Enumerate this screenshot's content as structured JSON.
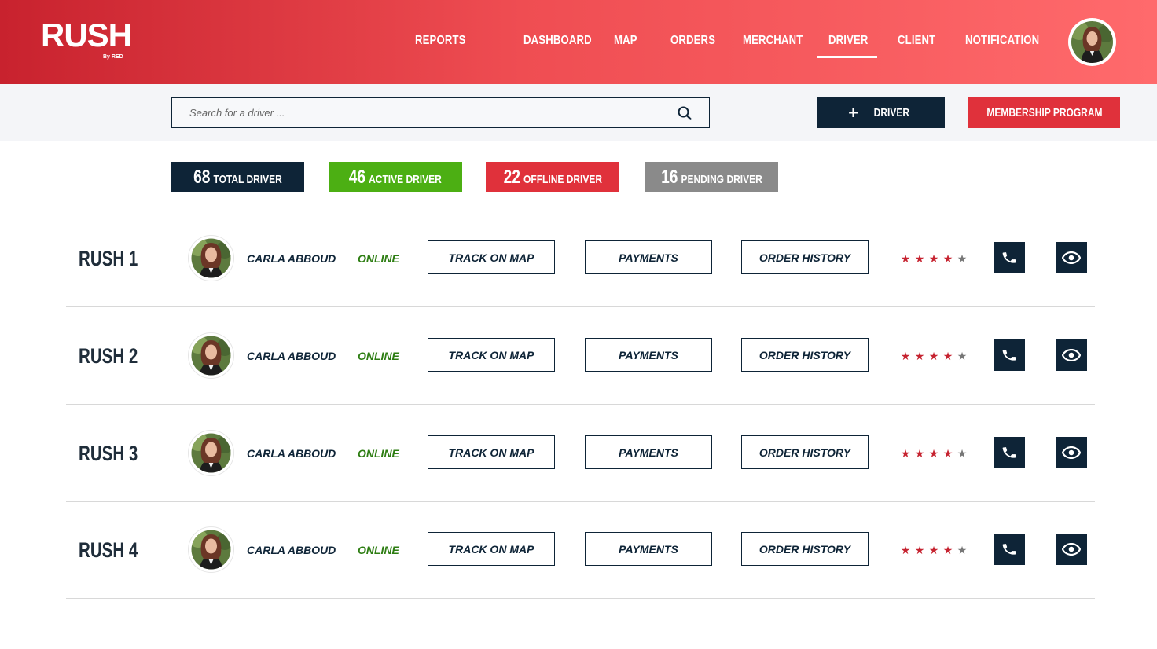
{
  "header": {
    "logo_text": "RUSH",
    "logo_sub": "By RED",
    "nav": [
      {
        "label": "REPORTS"
      },
      {
        "label": "DASHBOARD"
      },
      {
        "label": "MAP"
      },
      {
        "label": "ORDERS"
      },
      {
        "label": "MERCHANT"
      },
      {
        "label": "DRIVER",
        "active": true
      },
      {
        "label": "CLIENT"
      },
      {
        "label": "NOTIFICATION"
      }
    ],
    "profile_icon": "user-avatar"
  },
  "toolbar": {
    "search_placeholder": "Search for a driver ...",
    "add_driver_label": "DRIVER",
    "membership_label": "MEMBERSHIP PROGRAM"
  },
  "stats": [
    {
      "count": "68",
      "label": "TOTAL DRIVER",
      "color": "#0e2437"
    },
    {
      "count": "46",
      "label": "ACTIVE DRIVER",
      "color": "#4caf13"
    },
    {
      "count": "22",
      "label": "OFFLINE DRIVER",
      "color": "#e0313b"
    },
    {
      "count": "16",
      "label": "PENDING DRIVER",
      "color": "#8a8a8a"
    }
  ],
  "drivers": [
    {
      "id": "RUSH 1",
      "name": "CARLA ABBOUD",
      "status": "ONLINE",
      "rating": 4,
      "rating_max": 5
    },
    {
      "id": "RUSH 2",
      "name": "CARLA ABBOUD",
      "status": "ONLINE",
      "rating": 4,
      "rating_max": 5
    },
    {
      "id": "RUSH 3",
      "name": "CARLA ABBOUD",
      "status": "ONLINE",
      "rating": 4,
      "rating_max": 5
    },
    {
      "id": "RUSH 4",
      "name": "CARLA ABBOUD",
      "status": "ONLINE",
      "rating": 4,
      "rating_max": 5
    }
  ],
  "row_actions": {
    "track": "TRACK ON MAP",
    "payments": "PAYMENTS",
    "history": "ORDER HISTORY"
  },
  "colors": {
    "primary_dark": "#0e2437",
    "accent_red": "#e0313b",
    "online_green": "#2d7d12",
    "star_filled": "#c62330",
    "star_empty": "#777777"
  }
}
